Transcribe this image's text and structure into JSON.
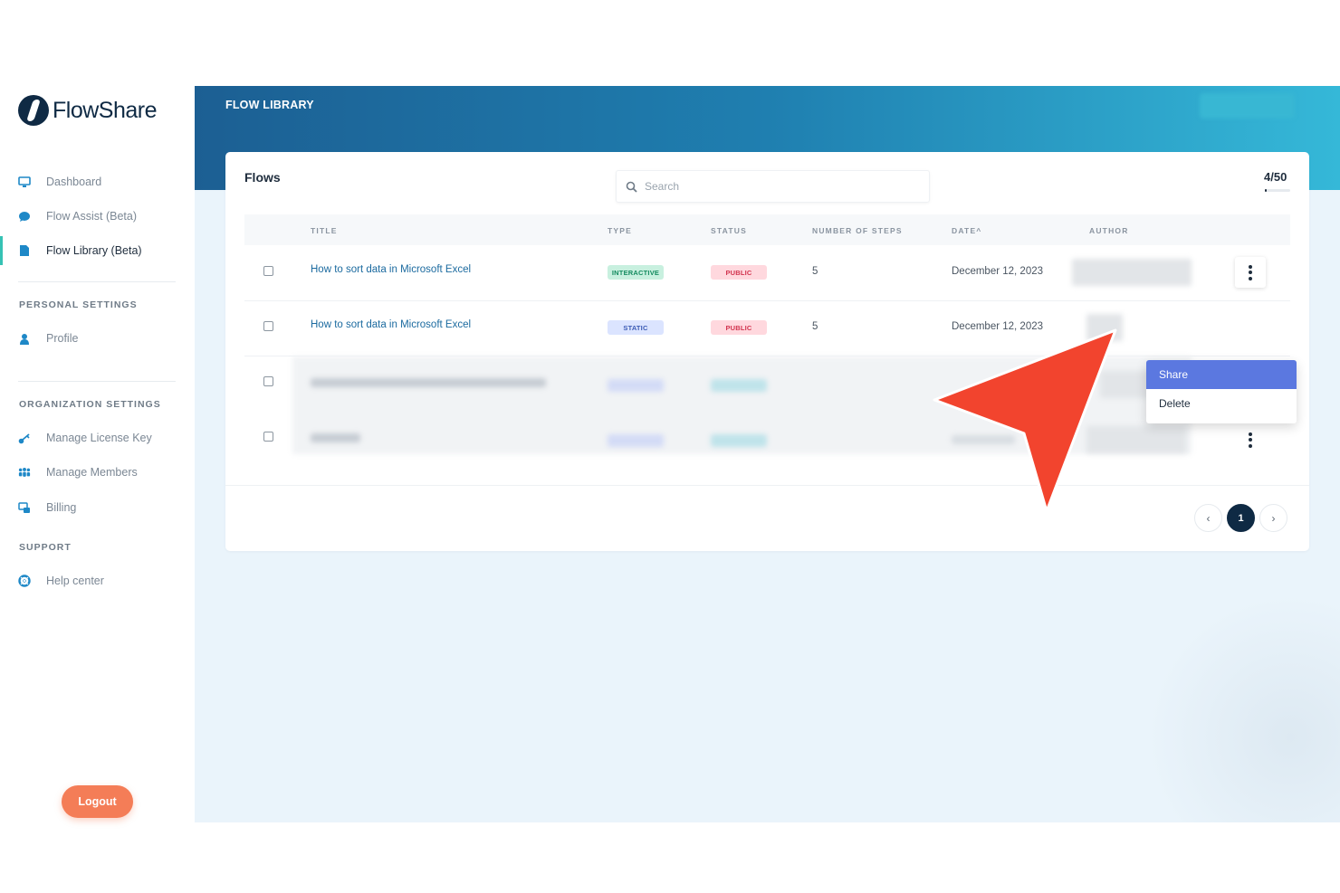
{
  "app": {
    "brand": "FlowShare"
  },
  "sidebar": {
    "items": [
      {
        "label": "Dashboard",
        "icon": "monitor-icon"
      },
      {
        "label": "Flow Assist (Beta)",
        "icon": "chat-bubble-icon"
      },
      {
        "label": "Flow Library (Beta)",
        "icon": "document-icon",
        "active": true
      }
    ],
    "personal_title": "PERSONAL SETTINGS",
    "personal_items": [
      {
        "label": "Profile",
        "icon": "user-icon"
      }
    ],
    "org_title": "ORGANIZATION SETTINGS",
    "org_items": [
      {
        "label": "Manage License Key",
        "icon": "key-icon"
      },
      {
        "label": "Manage Members",
        "icon": "users-icon"
      },
      {
        "label": "Billing",
        "icon": "billing-icon"
      }
    ],
    "support_title": "SUPPORT",
    "support_items": [
      {
        "label": "Help center",
        "icon": "lifebuoy-icon"
      }
    ],
    "logout_label": "Logout"
  },
  "header": {
    "title": "FLOW LIBRARY"
  },
  "card": {
    "title": "Flows",
    "search_placeholder": "Search",
    "counter": "4/50",
    "counter_fraction": 0.08
  },
  "table": {
    "columns": [
      "TITLE",
      "TYPE",
      "STATUS",
      "NUMBER OF STEPS",
      "DATE^",
      "AUTHOR"
    ],
    "rows": [
      {
        "title": "How to sort data in Microsoft Excel",
        "type": "INTERACTIVE",
        "status": "PUBLIC",
        "steps": "5",
        "date": "December 12, 2023"
      },
      {
        "title": "How to sort data in Microsoft Excel",
        "type": "STATIC",
        "status": "PUBLIC",
        "steps": "5",
        "date": "December 12, 2023"
      }
    ]
  },
  "context_menu": {
    "items": [
      "Share",
      "Delete"
    ],
    "highlighted": "Share"
  },
  "pagination": {
    "prev": "‹",
    "current": "1",
    "next": "›"
  },
  "colors": {
    "accent": "#36c2b4",
    "brand": "#0f2a44",
    "logout": "#f47d57",
    "menu_highlight": "#5b78e0",
    "annotation_arrow": "#f2442e"
  }
}
